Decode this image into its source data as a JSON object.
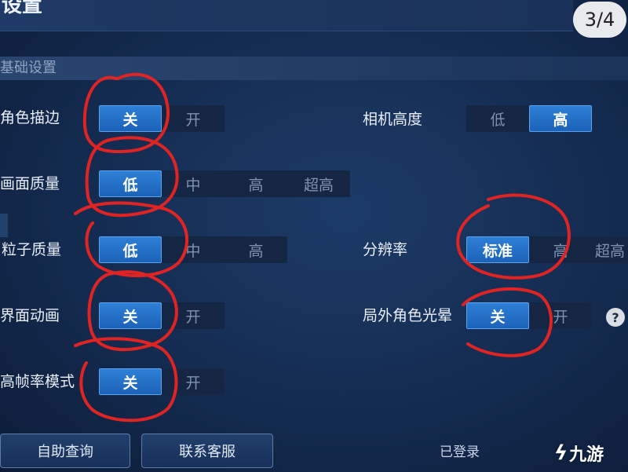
{
  "header": {
    "title": "设置",
    "page_indicator": "3/4"
  },
  "section": {
    "title": "基础设置"
  },
  "settings_left": [
    {
      "label": "角色描边",
      "options": [
        "关",
        "开"
      ],
      "selected": 0
    },
    {
      "label": "画面质量",
      "options": [
        "低",
        "中",
        "高",
        "超高"
      ],
      "selected": 0
    },
    {
      "label": "粒子质量",
      "options": [
        "低",
        "中",
        "高"
      ],
      "selected": 0
    },
    {
      "label": "界面动画",
      "options": [
        "关",
        "开"
      ],
      "selected": 0
    },
    {
      "label": "高帧率模式",
      "options": [
        "关",
        "开"
      ],
      "selected": 0
    }
  ],
  "settings_right": [
    {
      "label": "相机高度",
      "options": [
        "低",
        "高"
      ],
      "selected": 1
    },
    {
      "label": "分辨率",
      "options": [
        "标准",
        "高",
        "超高"
      ],
      "selected": 0
    },
    {
      "label": "局外角色光晕",
      "options": [
        "关",
        "开"
      ],
      "selected": 0
    }
  ],
  "help": {
    "glyph": "?"
  },
  "footer": {
    "self_service": "自助查询",
    "customer_service": "联系客服",
    "login_status": "已登录"
  },
  "watermark": {
    "glyph": "ϟ",
    "text": "九游"
  },
  "colors": {
    "background": "#142b50",
    "selected_option": "#2270c8",
    "annotation": "#e02424"
  }
}
